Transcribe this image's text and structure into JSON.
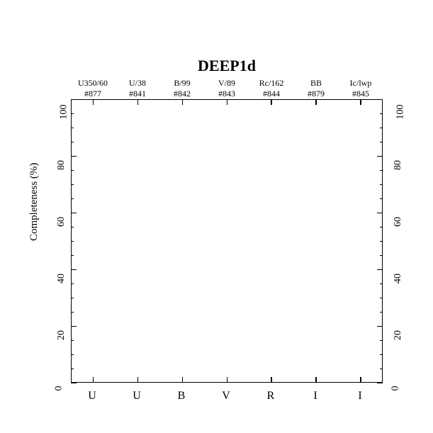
{
  "chart_data": {
    "type": "bar",
    "title": "DEEP1d",
    "ylabel": "Completeness (%)",
    "xlabel": "",
    "ylim": [
      0,
      100
    ],
    "categories": [
      "U",
      "U",
      "B",
      "V",
      "R",
      "I",
      "I"
    ],
    "values": [],
    "yticks": [
      0,
      20,
      40,
      60,
      80,
      100
    ],
    "top_labels_row1": [
      "U350/60",
      "U/38",
      "B/99",
      "V/89",
      "Rc/162",
      "BB",
      "Ic/lwp"
    ],
    "top_labels_row2": [
      "#877",
      "#841",
      "#842",
      "#843",
      "#844",
      "#879",
      "#845"
    ]
  }
}
